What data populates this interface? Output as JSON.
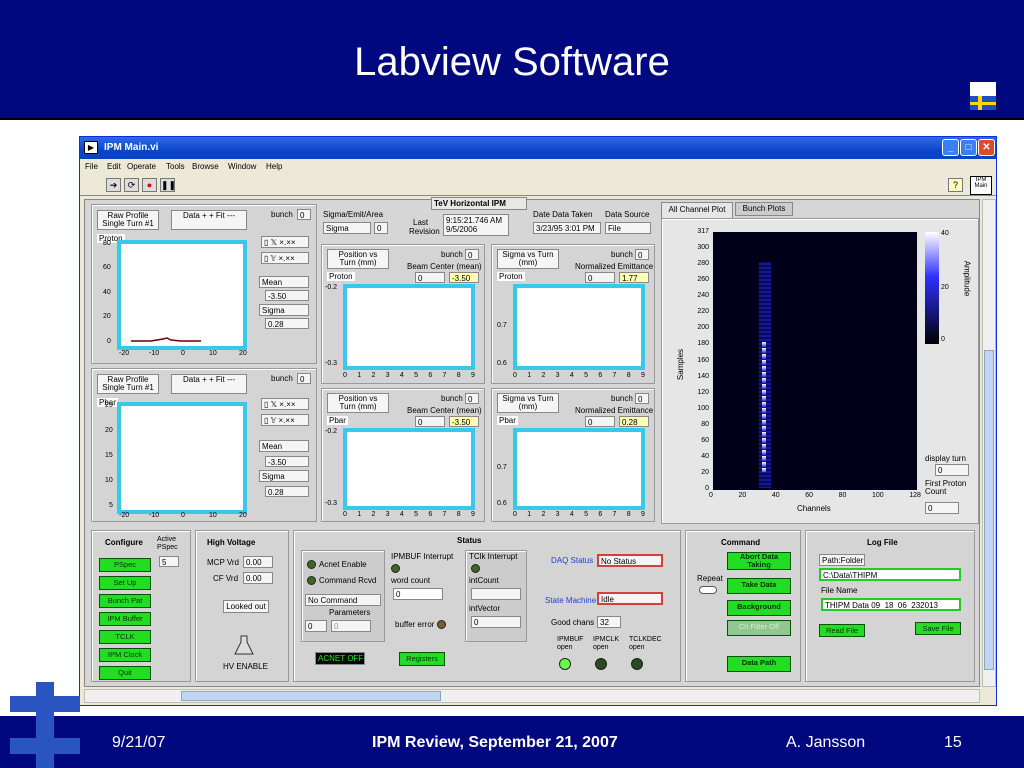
{
  "slide": {
    "title": "Labview Software",
    "footer_date": "9/21/07",
    "footer_center": "IPM Review, September 21, 2007",
    "footer_author": "A. Jansson",
    "footer_page": "15"
  },
  "window": {
    "title": "IPM Main.vi",
    "menu": [
      "File",
      "Edit",
      "Operate",
      "Tools",
      "Browse",
      "Window",
      "Help"
    ],
    "corner_label": "IPM Main"
  },
  "top": {
    "mode_title": "TeV Horizontal IPM",
    "sigma_label": "Sigma/Emit/Area",
    "sigma_value": "Sigma",
    "sigma_num": "0",
    "last_label": "Last",
    "revision_label": "Revision",
    "last_time": "9:15:21.746 AM",
    "last_date": "9/5/2006",
    "date_taken_label": "Date  Data Taken",
    "date_taken": "3/23/95 3:01 PM",
    "source_label": "Data Source",
    "source": "File"
  },
  "proton": {
    "raw_label": "Raw Profile Single Turn #1",
    "data_fit": "Data  + +  Fit  ---",
    "bunch_label": "bunch",
    "bunch": "0",
    "tag": "Proton",
    "mean_label": "Mean",
    "mean": "-3.50",
    "sigma_label": "Sigma",
    "sigma": "0.28",
    "yticks": [
      "80",
      "60",
      "40",
      "20",
      "0"
    ],
    "xticks": [
      "-20",
      "-10",
      "0",
      "10",
      "20"
    ],
    "pos_label": "Position vs Turn (mm)",
    "beam_center": "Beam Center (mean)",
    "pos_val": "0",
    "pos_out": "-3.50",
    "sig_label": "Sigma vs Turn (mm)",
    "norm_emit": "Normalized Emittance",
    "sig_val": "0",
    "sig_out": "1.77",
    "pos_yticks": [
      "-0.2",
      "-0.3"
    ],
    "sig_yticks": [
      "0.7",
      "0.6"
    ]
  },
  "pbar": {
    "raw_label": "Raw Profile Single Turn #1",
    "data_fit": "Data  + +  Fit  ---",
    "bunch_label": "bunch",
    "bunch": "0",
    "tag": "Pbar",
    "mean_label": "Mean",
    "mean": "-3.50",
    "sigma_label": "Sigma",
    "sigma": "0.28",
    "yticks": [
      "25",
      "20",
      "15",
      "10",
      "5"
    ],
    "xticks": [
      "-20",
      "-10",
      "0",
      "10",
      "20"
    ],
    "pos_label": "Position vs Turn (mm)",
    "beam_center": "Beam Center (mean)",
    "pos_val": "0",
    "pos_out": "-3.50",
    "sig_label": "Sigma vs Turn (mm)",
    "norm_emit": "Normalized Emittance",
    "sig_val": "0",
    "sig_out": "0.28",
    "pos_yticks": [
      "-0.2",
      "-0.3"
    ],
    "sig_yticks": [
      "0.7",
      "0.6"
    ]
  },
  "turn_xticks": [
    "0",
    "1",
    "2",
    "3",
    "4",
    "5",
    "6",
    "7",
    "8",
    "9"
  ],
  "tabs": [
    "All Channel Plot",
    "Bunch Plots"
  ],
  "channel_plot": {
    "ylabel": "Samples",
    "xlabel": "Channels",
    "yticks": [
      "317",
      "300",
      "280",
      "260",
      "240",
      "220",
      "200",
      "180",
      "160",
      "140",
      "120",
      "100",
      "80",
      "60",
      "40",
      "20",
      "0"
    ],
    "xticks": [
      "0",
      "20",
      "40",
      "60",
      "80",
      "100",
      "128"
    ],
    "amp_label": "Amplitude",
    "amp_ticks": [
      "40",
      "20",
      "0"
    ],
    "display_turn_label": "display turn",
    "display_turn": "0",
    "first_proton_label": "First Proton Count",
    "first_proton": "0"
  },
  "configure": {
    "title": "Configure",
    "active_label": "Active PSpec",
    "active": "5",
    "buttons": [
      "PSpec",
      "Set Up",
      "Bunch Pat",
      "IPM Buffer",
      "TCLK",
      "IPM Clock",
      "Quit"
    ]
  },
  "hv": {
    "title": "High Voltage",
    "mcp_label": "MCP Vrd",
    "mcp": "0.00",
    "cf_label": "CF Vrd",
    "cf": "0.00",
    "looked_out": "Looked out",
    "enable": "HV ENABLE"
  },
  "status": {
    "title": "Status",
    "acnet_enable": "Acnet Enable",
    "command_rcvd": "Command Rcvd",
    "no_command": "No Command",
    "parameters": "Parameters",
    "param_a": "0",
    "param_b": "0",
    "ipmbuf_int": "IPMBUF Interrupt",
    "word_count": "word count",
    "word_val": "0",
    "buffer_error": "buffer error",
    "tclk_int": "TClk Interrupt",
    "int_count": "intCount",
    "int_count_val": "",
    "int_vector": "intVector",
    "int_vector_val": "0",
    "acnet_off": "ACNET OFF",
    "registers": "Registers",
    "daq_label": "DAQ Status",
    "daq": "No Status",
    "sm_label": "State Machine",
    "sm": "Idle",
    "good_label": "Good chans",
    "good": "32",
    "ipmbuf_open": "IPMBUF open",
    "ipmclk_open": "IPMCLK open",
    "tclkdec_open": "TCLKDEC open"
  },
  "command": {
    "title": "Command",
    "repeat": "Repeat",
    "abort": "Abort Data Taking",
    "take": "Take Data",
    "background": "Background",
    "ch_filter": "Ch Filter Off",
    "data_path": "Data Path"
  },
  "logfile": {
    "title": "Log File",
    "path_label": "Path:Folder",
    "path": "C:\\Data\\THIPM",
    "file_label": "File Name",
    "file": "THIPM Data 09_18_06_232013",
    "read": "Read File",
    "save": "Save File"
  },
  "colors": {
    "plot_border": "#38c8ea",
    "green_button": "#22dd22",
    "slide_bar": "#000880"
  }
}
